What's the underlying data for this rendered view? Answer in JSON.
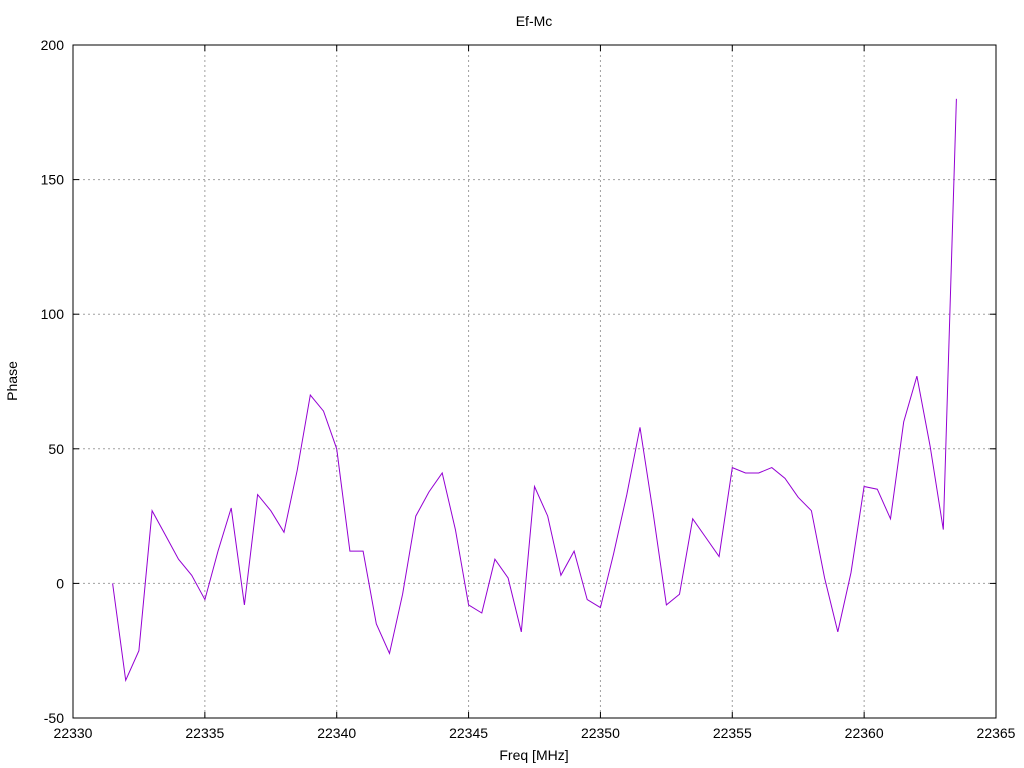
{
  "chart_data": {
    "type": "line",
    "title": "Ef-Mc",
    "xlabel": "Freq [MHz]",
    "ylabel": "Phase",
    "xlim": [
      22330,
      22365
    ],
    "ylim": [
      -50,
      200
    ],
    "xticks": [
      "22330",
      "22335",
      "22340",
      "22345",
      "22350",
      "22355",
      "22360",
      "22365"
    ],
    "yticks": [
      "-50",
      "0",
      "50",
      "100",
      "150",
      "200"
    ],
    "grid": true,
    "line_color": "#9400d3",
    "series": [
      {
        "x": [
          22331.5,
          22332,
          22332.5,
          22333,
          22333.5,
          22334,
          22334.5,
          22335,
          22335.5,
          22336,
          22336.5,
          22337,
          22337.5,
          22338,
          22338.5,
          22339,
          22339.5,
          22340,
          22340.5,
          22341,
          22341.5,
          22342,
          22342.5,
          22343,
          22343.5,
          22344,
          22344.5,
          22345,
          22345.5,
          22346,
          22346.5,
          22347,
          22347.5,
          22348,
          22348.5,
          22349,
          22349.5,
          22350,
          22350.5,
          22351,
          22351.5,
          22352,
          22352.5,
          22353,
          22353.5,
          22354,
          22354.5,
          22355,
          22355.5,
          22356,
          22356.5,
          22357,
          22357.5,
          22358,
          22358.5,
          22359,
          22359.5,
          22360,
          22360.5,
          22361,
          22361.5,
          22362,
          22362.5,
          22363,
          22363.5
        ],
        "y": [
          0,
          -36,
          -25,
          27,
          18,
          9,
          3,
          -6,
          12,
          28,
          -8,
          33,
          27,
          19,
          42,
          70,
          64,
          50,
          12,
          12,
          -15,
          -26,
          -4,
          25,
          34,
          41,
          20,
          -8,
          -11,
          9,
          2,
          -18,
          36,
          25,
          3,
          12,
          -6,
          -9,
          11,
          33,
          58,
          26,
          -8,
          -4,
          24,
          17,
          10,
          43,
          41,
          41,
          43,
          39,
          32,
          27,
          2,
          -18,
          4,
          36,
          35,
          24,
          60,
          77,
          51,
          20,
          180
        ]
      }
    ]
  }
}
